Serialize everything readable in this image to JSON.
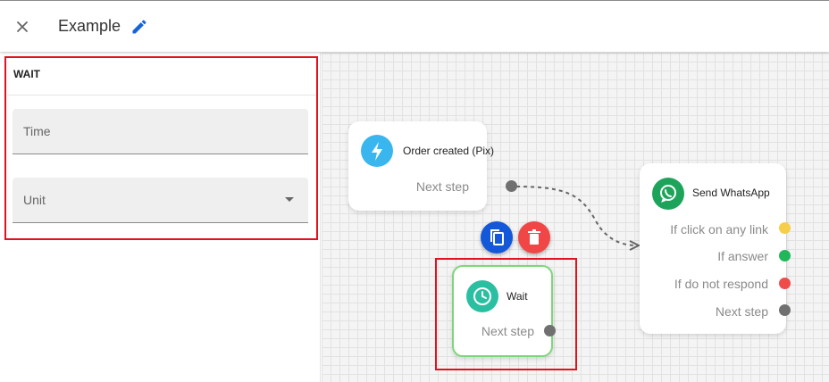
{
  "header": {
    "title": "Example"
  },
  "sidebar": {
    "panel_title": "WAIT",
    "fields": {
      "time_label": "Time",
      "unit_label": "Unit"
    }
  },
  "canvas": {
    "nodes": {
      "order": {
        "title": "Order created (Pix)",
        "output": "Next step",
        "accent": "#3ab6ef"
      },
      "wait": {
        "title": "Wait",
        "output": "Next step",
        "accent": "#2bbfa2",
        "border": "#7ed67a"
      },
      "whatsapp": {
        "title": "Send WhatsApp",
        "accent": "#1ea45a",
        "outputs": [
          {
            "label": "If click on any link",
            "color": "#f6cf4a"
          },
          {
            "label": "If answer",
            "color": "#1fb75a"
          },
          {
            "label": "If do not respond",
            "color": "#ef4b4b"
          },
          {
            "label": "Next step",
            "color": "#707070"
          }
        ]
      }
    },
    "actions": {
      "copy_color": "#1358d8",
      "delete_color": "#f04646"
    }
  }
}
